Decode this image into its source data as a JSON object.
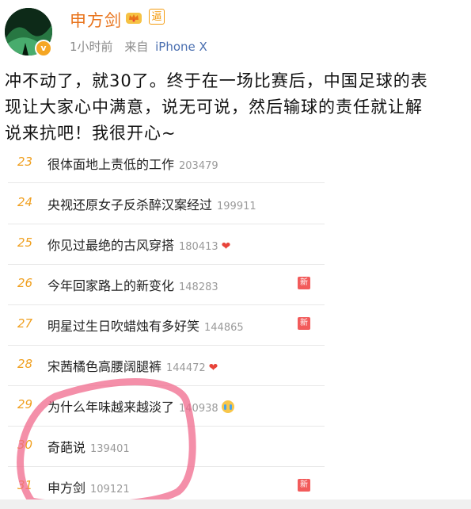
{
  "header": {
    "username": "申方剑",
    "yuan_badge": "逼",
    "verified_badge": "v",
    "time": "1小时前",
    "source_prefix": "来自",
    "device": "iPhone X"
  },
  "post": {
    "lines": [
      "冲不动了，就30了。终于在一场比赛后，中国足球的表",
      "现让大家心中满意，说无可说，然后输球的责任就让解",
      "说来抗吧！我很开心~"
    ]
  },
  "trending": {
    "cut_row": {
      "rank": "23",
      "title": "很体面地上责低的工作",
      "count": "203479"
    },
    "rows": [
      {
        "rank": "24",
        "title": "央视还原女子反杀醉汉案经过",
        "count": "199911",
        "icon": "",
        "new": ""
      },
      {
        "rank": "25",
        "title": "你见过最绝的古风穿搭",
        "count": "180413",
        "icon": "heart-icon",
        "new": ""
      },
      {
        "rank": "26",
        "title": "今年回家路上的新变化",
        "count": "148283",
        "icon": "",
        "new": "新"
      },
      {
        "rank": "27",
        "title": "明星过生日吹蜡烛有多好笑",
        "count": "144865",
        "icon": "",
        "new": "新"
      },
      {
        "rank": "28",
        "title": "宋茜橘色高腰阔腿裤",
        "count": "144472",
        "icon": "heart-icon",
        "new": ""
      },
      {
        "rank": "29",
        "title": "为什么年味越来越淡了",
        "count": "140938",
        "icon": "crying-face-icon",
        "new": ""
      },
      {
        "rank": "30",
        "title": "奇葩说",
        "count": "139401",
        "icon": "",
        "new": ""
      },
      {
        "rank": "31",
        "title": "申方剑",
        "count": "109121",
        "icon": "",
        "new": "新"
      }
    ]
  },
  "colors": {
    "username": "#e8731b",
    "rank": "#f0a020",
    "new_badge": "#f25b5b",
    "circle_annotation": "#f06a8c"
  }
}
